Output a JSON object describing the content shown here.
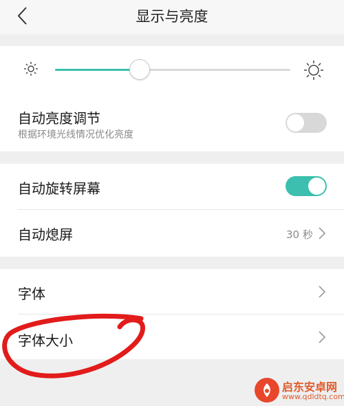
{
  "header": {
    "title": "显示与亮度"
  },
  "brightness": {
    "level": 0.36,
    "auto_label": "自动亮度调节",
    "auto_sublabel": "根据环境光线情况优化亮度",
    "auto_enabled": false
  },
  "rotation": {
    "label": "自动旋转屏幕",
    "enabled": true
  },
  "screen_off": {
    "label": "自动熄屏",
    "value": "30 秒"
  },
  "font": {
    "label": "字体"
  },
  "font_size": {
    "label": "字体大小"
  },
  "watermark": {
    "name": "启东安卓网",
    "url": "www.qdldtq.com"
  },
  "colors": {
    "accent": "#3cbfae",
    "toggle_off": "#d8d8d8",
    "annotation": "#e21b1b"
  }
}
